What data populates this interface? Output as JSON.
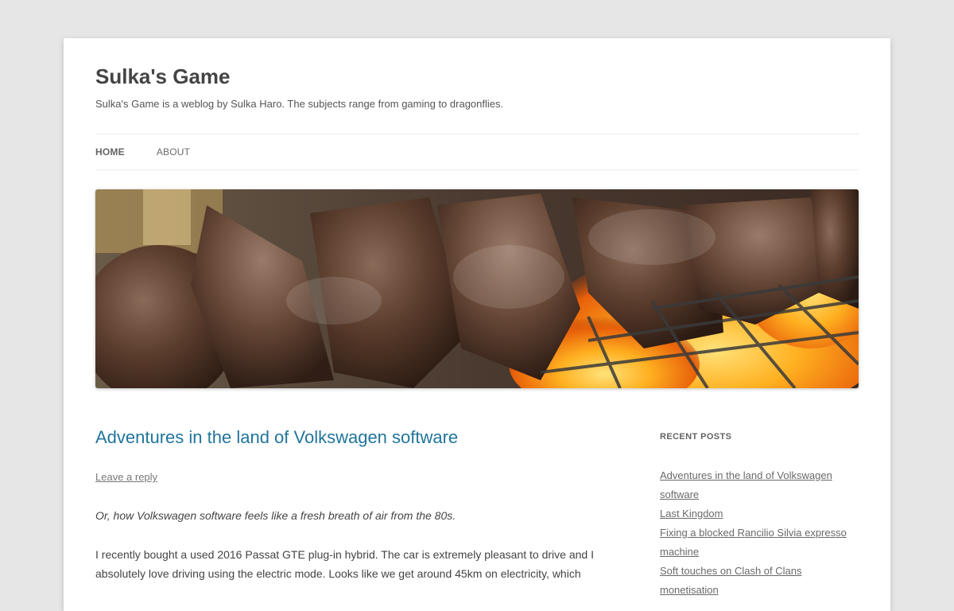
{
  "site": {
    "title": "Sulka's Game",
    "description": "Sulka's Game is a weblog by Sulka Haro. The subjects range from gaming to dragonflies."
  },
  "nav": {
    "items": [
      {
        "label": "HOME",
        "active": true
      },
      {
        "label": "ABOUT",
        "active": false
      }
    ]
  },
  "header_image": {
    "alt": "Grilled meat over open flame"
  },
  "post": {
    "title": "Adventures in the land of Volkswagen software",
    "leave_reply": "Leave a reply",
    "excerpt": "Or, how Volkswagen software feels like a fresh breath of air from the 80s.",
    "body": "I recently bought a used 2016 Passat GTE plug-in hybrid. The car is extremely pleasant to drive and I absolutely love driving using the electric mode. Looks like we get around 45km on electricity, which"
  },
  "sidebar": {
    "heading": "RECENT POSTS",
    "recent_posts": [
      "Adventures in the land of Volkswagen software",
      "Last Kingdom",
      "Fixing a blocked Rancilio Silvia expresso machine",
      "Soft touches on Clash of Clans monetisation"
    ]
  },
  "colors": {
    "link": "#21759b",
    "background": "#e6e6e6"
  }
}
